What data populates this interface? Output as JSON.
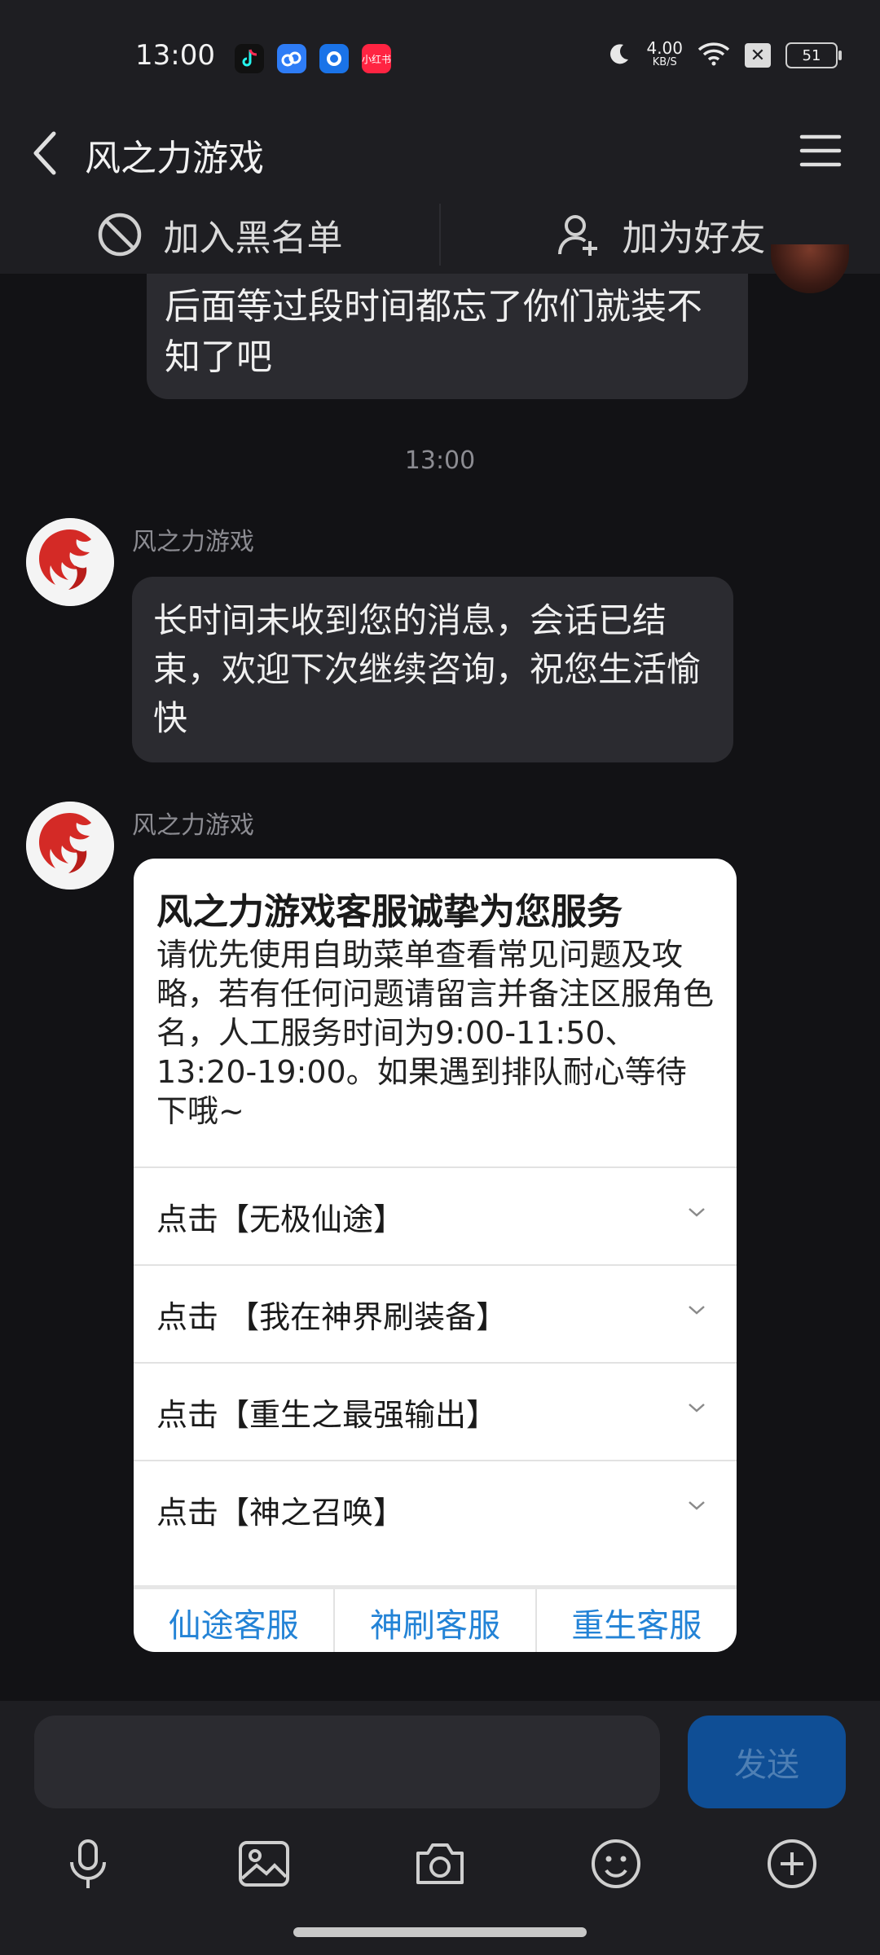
{
  "status_bar": {
    "time": "13:00",
    "apps": [
      {
        "icon": "tiktok-icon",
        "label": "",
        "color": "#111111"
      },
      {
        "icon": "cloud-icon",
        "label": "",
        "color": "#2e7cf6"
      },
      {
        "icon": "browser-icon",
        "label": "",
        "color": "#1a73e8"
      },
      {
        "icon": "xiaohongshu-icon",
        "label": "小红书",
        "color": "#ff2442"
      }
    ],
    "speed_value": "4.00",
    "speed_unit": "KB/S",
    "battery": "51"
  },
  "header": {
    "title": "风之力游戏"
  },
  "actions": {
    "block_label": "加入黑名单",
    "add_friend_label": "加为好友"
  },
  "chat": {
    "prev_message": "后面等过段时间都忘了你们就装不知了吧",
    "timestamp": "13:00",
    "messages": [
      {
        "sender": "风之力游戏",
        "text": "长时间未收到您的消息，会话已结束，欢迎下次继续咨询，祝您生活愉快"
      }
    ],
    "card": {
      "sender": "风之力游戏",
      "title": "风之力游戏客服诚挚为您服务",
      "body": "请优先使用自助菜单查看常见问题及攻略，若有任何问题请留言并备注区服角色名，人工服务时间为9:00-11:50、13:20-19:00。如果遇到排队耐心等待下哦~",
      "items": [
        {
          "label": "点击【无极仙途】"
        },
        {
          "label": "点击 【我在神界刷装备】"
        },
        {
          "label": "点击【重生之最强输出】"
        },
        {
          "label": "点击【神之召唤】"
        }
      ],
      "buttons": [
        {
          "label": "仙途客服"
        },
        {
          "label": "神刷客服"
        },
        {
          "label": "重生客服"
        }
      ]
    }
  },
  "input": {
    "placeholder": "",
    "send_label": "发送"
  },
  "toolbar": [
    "microphone-icon",
    "image-icon",
    "camera-icon",
    "emoji-icon",
    "plus-icon"
  ],
  "colors": {
    "background": "#121215",
    "bar": "#1e1e22",
    "bubble": "#2b2b30",
    "link_blue": "#2383d6",
    "send_button": "#0f4e95"
  }
}
